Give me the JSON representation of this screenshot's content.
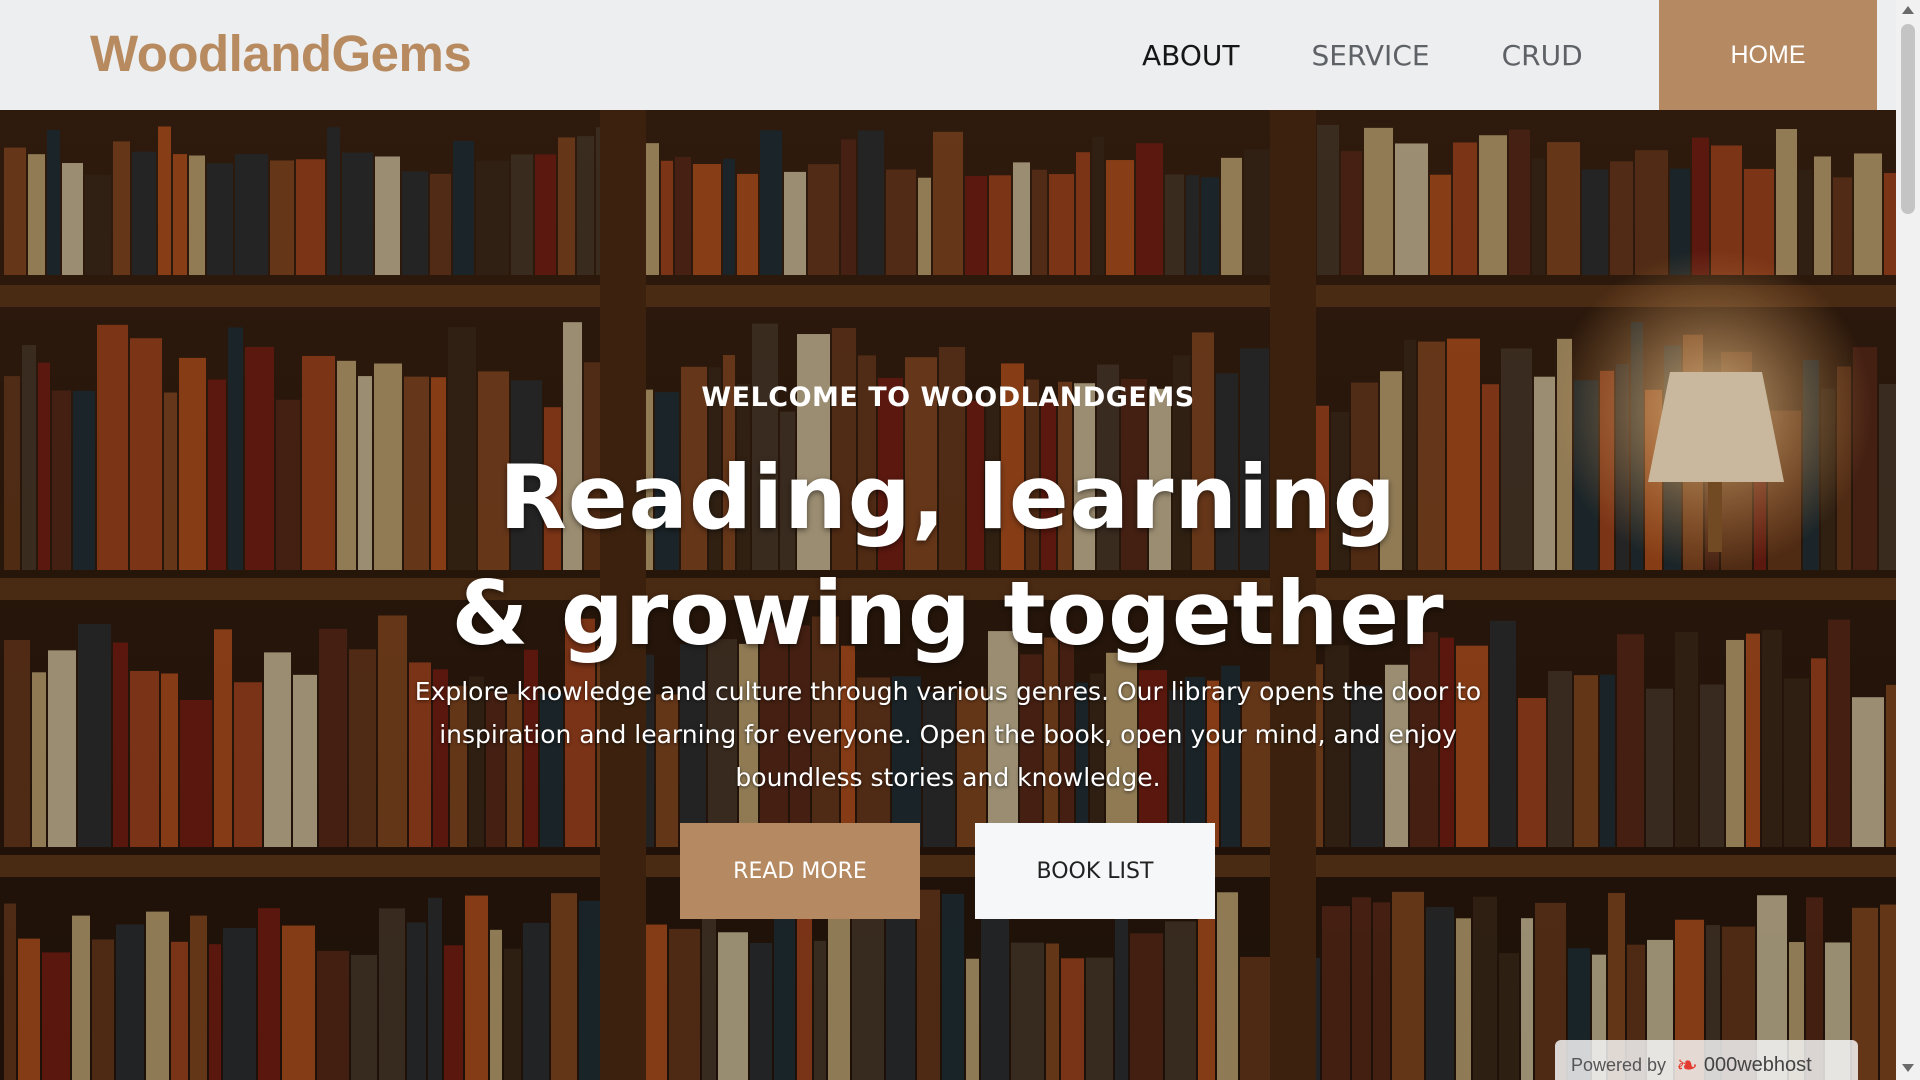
{
  "header": {
    "brand": "WoodlandGems",
    "nav": {
      "about": "ABOUT",
      "service": "SERVICE",
      "crud": "CRUD",
      "home": "HOME"
    }
  },
  "hero": {
    "kicker": "WELCOME TO WOODLANDGEMS",
    "headline_line1": "Reading, learning",
    "headline_line2": "& growing together",
    "lead": "Explore knowledge and culture through various genres. Our library opens the door to inspiration and learning for everyone. Open the book, open your mind, and enjoy boundless stories and knowledge.",
    "read_more": "READ MORE",
    "book_list": "BOOK LIST"
  },
  "badge": {
    "powered_by": "Powered by",
    "host": "000webhost"
  },
  "colors": {
    "accent": "#b58a62",
    "brand": "#b88a60",
    "nav_bg": "#eceeef"
  },
  "icons": {
    "badge_logo": "000webhost-logo-icon"
  }
}
